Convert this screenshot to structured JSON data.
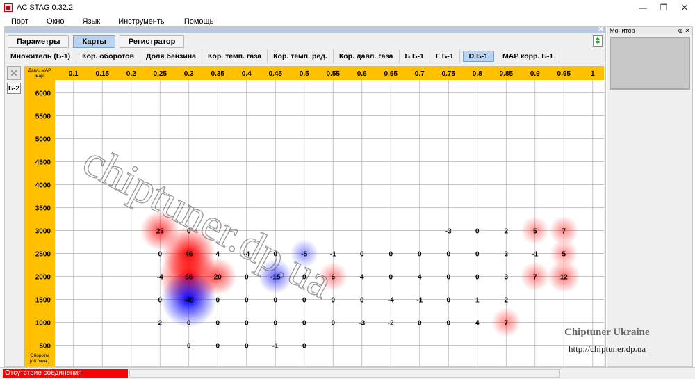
{
  "window": {
    "title": "AC STAG 0.32.2",
    "minimize": "—",
    "restore": "❐",
    "close": "✕"
  },
  "menu": [
    "Порт",
    "Окно",
    "Язык",
    "Инструменты",
    "Помощь"
  ],
  "tabs": [
    {
      "label": "Параметры",
      "active": false
    },
    {
      "label": "Карты",
      "active": true
    },
    {
      "label": "Регистратор",
      "active": false
    }
  ],
  "help_icon": "⁑",
  "subtabs": [
    {
      "label": "Множитель (Б-1)",
      "active": false
    },
    {
      "label": "Кор. оборотов",
      "active": false
    },
    {
      "label": "Доля бензина",
      "active": false
    },
    {
      "label": "Кор. темп. газа",
      "active": false
    },
    {
      "label": "Кор. темп. ред.",
      "active": false
    },
    {
      "label": "Кор. давл. газа",
      "active": false
    },
    {
      "label": "Б Б-1",
      "active": false
    },
    {
      "label": "Г Б-1",
      "active": false
    },
    {
      "label": "D Б-1",
      "active": true
    },
    {
      "label": "MAP корр. Б-1",
      "active": false
    }
  ],
  "side_tools": {
    "x_label": "✕",
    "b2_label": "Б-2"
  },
  "map": {
    "corner_label_1": "Давл. MAP",
    "corner_label_2": "[Бар]",
    "y_axis_label_1": "Обороты",
    "y_axis_label_2": "[об./мин.]",
    "x_ticks": [
      "0.1",
      "0.15",
      "0.2",
      "0.25",
      "0.3",
      "0.35",
      "0.4",
      "0.45",
      "0.5",
      "0.55",
      "0.6",
      "0.65",
      "0.7",
      "0.75",
      "0.8",
      "0.85",
      "0.9",
      "0.95",
      "1"
    ],
    "y_ticks": [
      "6000",
      "5500",
      "5000",
      "4500",
      "4000",
      "3500",
      "3000",
      "2500",
      "2000",
      "1500",
      "1000",
      "500"
    ],
    "cells": [
      {
        "rpm": 3000,
        "map": 0.25,
        "value": "23"
      },
      {
        "rpm": 3000,
        "map": 0.3,
        "value": "0"
      },
      {
        "rpm": 3000,
        "map": 0.75,
        "value": "-3"
      },
      {
        "rpm": 3000,
        "map": 0.8,
        "value": "0"
      },
      {
        "rpm": 3000,
        "map": 0.85,
        "value": "2"
      },
      {
        "rpm": 3000,
        "map": 0.9,
        "value": "5"
      },
      {
        "rpm": 3000,
        "map": 0.95,
        "value": "7"
      },
      {
        "rpm": 2500,
        "map": 0.25,
        "value": "0"
      },
      {
        "rpm": 2500,
        "map": 0.3,
        "value": "46"
      },
      {
        "rpm": 2500,
        "map": 0.35,
        "value": "4"
      },
      {
        "rpm": 2500,
        "map": 0.4,
        "value": "-4"
      },
      {
        "rpm": 2500,
        "map": 0.45,
        "value": "0"
      },
      {
        "rpm": 2500,
        "map": 0.5,
        "value": "-5"
      },
      {
        "rpm": 2500,
        "map": 0.55,
        "value": "-1"
      },
      {
        "rpm": 2500,
        "map": 0.6,
        "value": "0"
      },
      {
        "rpm": 2500,
        "map": 0.65,
        "value": "0"
      },
      {
        "rpm": 2500,
        "map": 0.7,
        "value": "0"
      },
      {
        "rpm": 2500,
        "map": 0.75,
        "value": "0"
      },
      {
        "rpm": 2500,
        "map": 0.8,
        "value": "0"
      },
      {
        "rpm": 2500,
        "map": 0.85,
        "value": "3"
      },
      {
        "rpm": 2500,
        "map": 0.9,
        "value": "-1"
      },
      {
        "rpm": 2500,
        "map": 0.95,
        "value": "5"
      },
      {
        "rpm": 2000,
        "map": 0.25,
        "value": "-4"
      },
      {
        "rpm": 2000,
        "map": 0.3,
        "value": "56"
      },
      {
        "rpm": 2000,
        "map": 0.35,
        "value": "20"
      },
      {
        "rpm": 2000,
        "map": 0.4,
        "value": "0"
      },
      {
        "rpm": 2000,
        "map": 0.45,
        "value": "-15"
      },
      {
        "rpm": 2000,
        "map": 0.5,
        "value": "0"
      },
      {
        "rpm": 2000,
        "map": 0.55,
        "value": "6"
      },
      {
        "rpm": 2000,
        "map": 0.6,
        "value": "4"
      },
      {
        "rpm": 2000,
        "map": 0.65,
        "value": "0"
      },
      {
        "rpm": 2000,
        "map": 0.7,
        "value": "4"
      },
      {
        "rpm": 2000,
        "map": 0.75,
        "value": "0"
      },
      {
        "rpm": 2000,
        "map": 0.8,
        "value": "0"
      },
      {
        "rpm": 2000,
        "map": 0.85,
        "value": "3"
      },
      {
        "rpm": 2000,
        "map": 0.9,
        "value": "7"
      },
      {
        "rpm": 2000,
        "map": 0.95,
        "value": "12"
      },
      {
        "rpm": 1500,
        "map": 0.25,
        "value": "0"
      },
      {
        "rpm": 1500,
        "map": 0.3,
        "value": "-49"
      },
      {
        "rpm": 1500,
        "map": 0.35,
        "value": "0"
      },
      {
        "rpm": 1500,
        "map": 0.4,
        "value": "0"
      },
      {
        "rpm": 1500,
        "map": 0.45,
        "value": "0"
      },
      {
        "rpm": 1500,
        "map": 0.5,
        "value": "0"
      },
      {
        "rpm": 1500,
        "map": 0.55,
        "value": "0"
      },
      {
        "rpm": 1500,
        "map": 0.6,
        "value": "0"
      },
      {
        "rpm": 1500,
        "map": 0.65,
        "value": "-4"
      },
      {
        "rpm": 1500,
        "map": 0.7,
        "value": "-1"
      },
      {
        "rpm": 1500,
        "map": 0.75,
        "value": "0"
      },
      {
        "rpm": 1500,
        "map": 0.8,
        "value": "1"
      },
      {
        "rpm": 1500,
        "map": 0.85,
        "value": "2"
      },
      {
        "rpm": 1000,
        "map": 0.25,
        "value": "2"
      },
      {
        "rpm": 1000,
        "map": 0.3,
        "value": "0"
      },
      {
        "rpm": 1000,
        "map": 0.35,
        "value": "0"
      },
      {
        "rpm": 1000,
        "map": 0.4,
        "value": "0"
      },
      {
        "rpm": 1000,
        "map": 0.45,
        "value": "0"
      },
      {
        "rpm": 1000,
        "map": 0.5,
        "value": "0"
      },
      {
        "rpm": 1000,
        "map": 0.55,
        "value": "0"
      },
      {
        "rpm": 1000,
        "map": 0.6,
        "value": "-3"
      },
      {
        "rpm": 1000,
        "map": 0.65,
        "value": "-2"
      },
      {
        "rpm": 1000,
        "map": 0.7,
        "value": "0"
      },
      {
        "rpm": 1000,
        "map": 0.75,
        "value": "0"
      },
      {
        "rpm": 1000,
        "map": 0.8,
        "value": "4"
      },
      {
        "rpm": 1000,
        "map": 0.85,
        "value": "7"
      },
      {
        "rpm": 500,
        "map": 0.3,
        "value": "0"
      },
      {
        "rpm": 500,
        "map": 0.35,
        "value": "0"
      },
      {
        "rpm": 500,
        "map": 0.4,
        "value": "0"
      },
      {
        "rpm": 500,
        "map": 0.45,
        "value": "-1"
      },
      {
        "rpm": 500,
        "map": 0.5,
        "value": "0"
      }
    ],
    "colors": {
      "axis_bg": "#ffc000",
      "positive": "#ff0000",
      "negative": "#0000ff",
      "grid": "#b0b0b0"
    }
  },
  "watermark": {
    "main": "chiptuner.dp.ua",
    "brand": "Chiptuner Ukraine",
    "url": "http://chiptuner.dp.ua"
  },
  "monitor": {
    "title": "Монитор",
    "pin": "⊕",
    "close": "✕"
  },
  "status": {
    "text": "Отсутствие соединения"
  }
}
